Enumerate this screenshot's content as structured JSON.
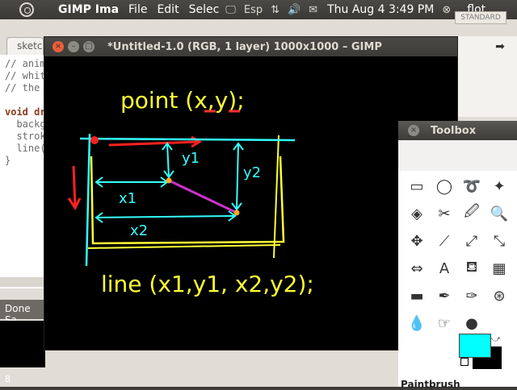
{
  "top_panel": {
    "app_name": "GIMP Ima",
    "menu": [
      "File",
      "Edit",
      "Selec"
    ],
    "language": "Esp",
    "clock": "Thu Aug 4  3:49 PM",
    "user": "flot"
  },
  "editor": {
    "tab_label": "sketc",
    "standard_label": "STANDARD",
    "code_lines": [
      "// anim",
      "// whit",
      "// the",
      "",
      "void dr",
      "  backg",
      "  strok",
      "  line(",
      "}"
    ],
    "status": "Done Sa",
    "line_number": "8"
  },
  "gimp": {
    "title": "*Untitled-1.0 (RGB, 1 layer) 1000x1000 – GIMP",
    "drawing": {
      "point_label": "point (x,y);",
      "line_label": "line (x1,y1, x2,y2);",
      "x1": "x1",
      "y1": "y1",
      "x2": "x2",
      "y2": "y2"
    }
  },
  "toolbox": {
    "title": "Toolbox",
    "tools": [
      "rect-select-icon",
      "ellipse-select-icon",
      "lasso-icon",
      "fuzzy-select-icon",
      "select-by-color-icon",
      "scissors-icon",
      "color-picker-icon",
      "zoom-icon",
      "move-icon",
      "knife-icon",
      "transform-icon",
      "scale-icon",
      "flip-icon",
      "text-icon",
      "bucket-fill-icon",
      "blend-icon",
      "eraser-icon",
      "pencil-icon",
      "ink-icon",
      "clone-icon",
      "blur-icon",
      "smudge-icon",
      "dodge-icon"
    ],
    "tool_glyphs": [
      "▭",
      "◯",
      "➰",
      "✦",
      "◈",
      "✂",
      "🖉",
      "🔍",
      "✥",
      "⟋",
      "⤢",
      "⤡",
      "⇔",
      "A",
      "⛾",
      "▦",
      "▬",
      "✒",
      "✑",
      "⊛",
      "💧",
      "☞",
      "●"
    ],
    "fg_color": "#00ffff",
    "bg_color": "#000000",
    "active_tool": "Paintbrush"
  }
}
